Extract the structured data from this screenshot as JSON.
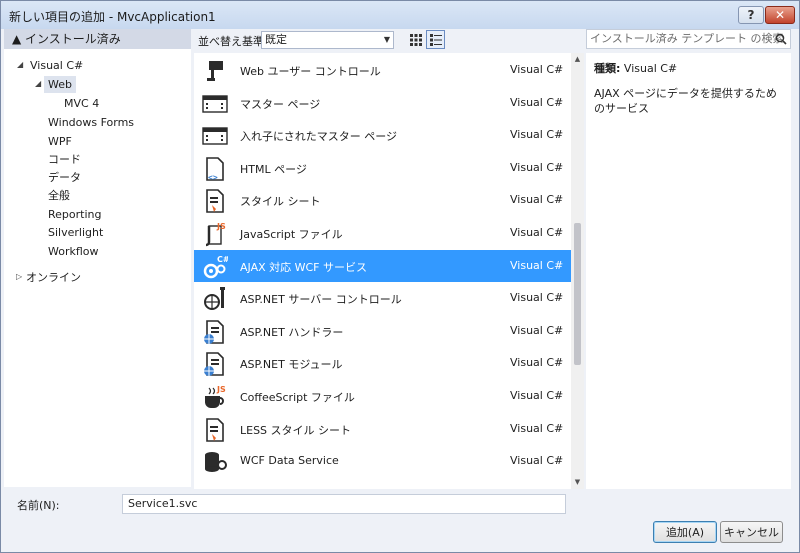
{
  "window": {
    "title": "新しい項目の追加 - MvcApplication1",
    "help_glyph": "?",
    "close_glyph": "✕"
  },
  "left": {
    "header": "▲ インストール済み",
    "tree": [
      {
        "label": "Visual C#",
        "arrow": "◢"
      },
      {
        "label": "Web",
        "arrow": "◢"
      },
      {
        "label": "MVC 4"
      },
      {
        "label": "Windows Forms"
      },
      {
        "label": "WPF"
      },
      {
        "label": "コード"
      },
      {
        "label": "データ"
      },
      {
        "label": "全般"
      },
      {
        "label": "Reporting"
      },
      {
        "label": "Silverlight"
      },
      {
        "label": "Workflow"
      },
      {
        "label": "オンライン",
        "arrow": "▷"
      }
    ]
  },
  "toolbar": {
    "sort_label": "並べ替え基準:",
    "sort_value": "既定"
  },
  "search": {
    "placeholder": "インストール済み テンプレート の検索"
  },
  "items": [
    {
      "name": "Web ユーザー コントロール",
      "lang": "Visual C#",
      "icon": "web-user-control-icon"
    },
    {
      "name": "マスター ページ",
      "lang": "Visual C#",
      "icon": "master-page-icon"
    },
    {
      "name": "入れ子にされたマスター ページ",
      "lang": "Visual C#",
      "icon": "nested-master-page-icon"
    },
    {
      "name": "HTML ページ",
      "lang": "Visual C#",
      "icon": "html-page-icon"
    },
    {
      "name": "スタイル シート",
      "lang": "Visual C#",
      "icon": "style-sheet-icon"
    },
    {
      "name": "JavaScript ファイル",
      "lang": "Visual C#",
      "icon": "javascript-file-icon"
    },
    {
      "name": "AJAX 対応 WCF サービス",
      "lang": "Visual C#",
      "icon": "ajax-wcf-service-icon",
      "selected": true
    },
    {
      "name": "ASP.NET サーバー コントロール",
      "lang": "Visual C#",
      "icon": "server-control-icon"
    },
    {
      "name": "ASP.NET ハンドラー",
      "lang": "Visual C#",
      "icon": "handler-icon"
    },
    {
      "name": "ASP.NET モジュール",
      "lang": "Visual C#",
      "icon": "module-icon"
    },
    {
      "name": "CoffeeScript ファイル",
      "lang": "Visual C#",
      "icon": "coffeescript-file-icon"
    },
    {
      "name": "LESS スタイル シート",
      "lang": "Visual C#",
      "icon": "less-style-sheet-icon"
    },
    {
      "name": "WCF Data Service",
      "lang": "Visual C#",
      "icon": "wcf-data-service-icon"
    }
  ],
  "details": {
    "type_label": "種類:",
    "type_value": "Visual C#",
    "description": "AJAX ページにデータを提供するためのサービス"
  },
  "bottom": {
    "name_label": "名前(N):",
    "name_value": "Service1.svc",
    "ok_label": "追加(A)",
    "cancel_label": "キャンセル"
  },
  "colors": {
    "selection": "#3399ff",
    "icon_dark": "#2b2b2b",
    "icon_orange": "#e8672a",
    "icon_blue": "#3a7fd0",
    "icon_green": "#2e9b3a"
  }
}
